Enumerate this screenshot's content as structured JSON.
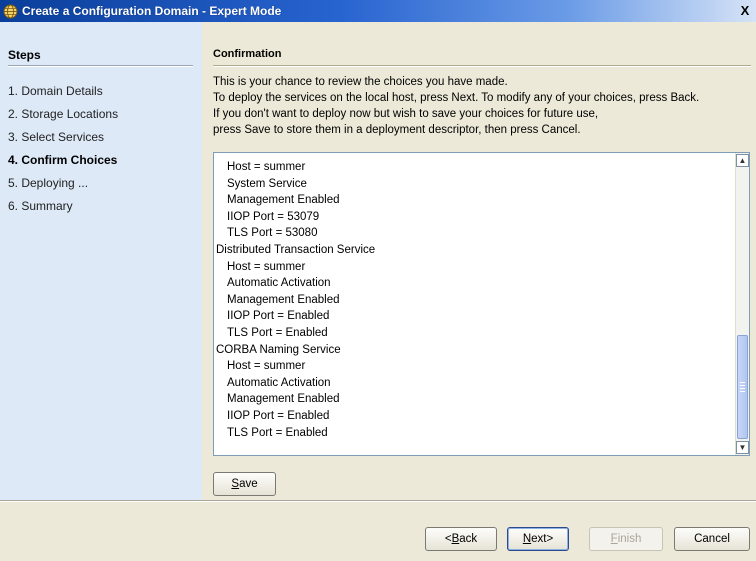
{
  "window": {
    "title": "Create a Configuration Domain - Expert Mode",
    "close_label": "X",
    "icon": "globe-icon"
  },
  "sidebar": {
    "heading": "Steps",
    "steps": [
      {
        "label": "1. Domain Details",
        "current": false
      },
      {
        "label": "2. Storage Locations",
        "current": false
      },
      {
        "label": "3. Select Services",
        "current": false
      },
      {
        "label": "4. Confirm Choices",
        "current": true
      },
      {
        "label": "5. Deploying ...",
        "current": false
      },
      {
        "label": "6. Summary",
        "current": false
      }
    ]
  },
  "main": {
    "heading": "Confirmation",
    "intro": [
      "This is your chance to review the choices you have made.",
      "To deploy the services on the local host, press Next. To modify any of your choices, press Back.",
      "If you don't want to deploy now but wish to save your choices for future use,",
      "press Save to store them in a deployment descriptor, then press Cancel."
    ],
    "summary_lines": [
      {
        "text": "Host = summer",
        "indent": true
      },
      {
        "text": "System Service",
        "indent": true
      },
      {
        "text": "Management Enabled",
        "indent": true
      },
      {
        "text": "IIOP Port = 53079",
        "indent": true
      },
      {
        "text": "TLS Port = 53080",
        "indent": true
      },
      {
        "text": "Distributed Transaction Service",
        "indent": false
      },
      {
        "text": "Host = summer",
        "indent": true
      },
      {
        "text": "Automatic Activation",
        "indent": true
      },
      {
        "text": "Management Enabled",
        "indent": true
      },
      {
        "text": "IIOP Port = Enabled",
        "indent": true
      },
      {
        "text": "TLS Port = Enabled",
        "indent": true
      },
      {
        "text": "CORBA Naming Service",
        "indent": false
      },
      {
        "text": "Host = summer",
        "indent": true
      },
      {
        "text": "Automatic Activation",
        "indent": true
      },
      {
        "text": "Management Enabled",
        "indent": true
      },
      {
        "text": "IIOP Port = Enabled",
        "indent": true
      },
      {
        "text": "TLS Port = Enabled",
        "indent": true
      }
    ],
    "save_button": {
      "mnemonic": "S",
      "rest": "ave"
    }
  },
  "footer": {
    "back": {
      "prefix": "<",
      "mnemonic": "B",
      "rest": "ack"
    },
    "next": {
      "mnemonic": "N",
      "rest": "ext>"
    },
    "finish": {
      "mnemonic": "F",
      "rest": "inish",
      "enabled": false
    },
    "cancel": {
      "label": "Cancel"
    }
  },
  "colors": {
    "sidebar_bg": "#dde9f7",
    "dialog_bg": "#ece9d8",
    "titlebar": "#0a3e9a"
  }
}
